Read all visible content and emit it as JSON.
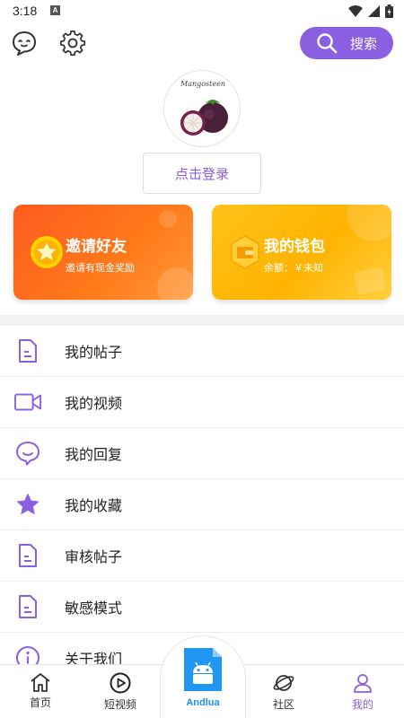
{
  "status_bar": {
    "time": "3:18",
    "notification_badge": "A"
  },
  "top_bar": {
    "search_label": "搜索",
    "accent": "#8a5fe0"
  },
  "profile": {
    "avatar_caption": "Mangosteen",
    "login_label": "点击登录"
  },
  "cards": {
    "invite": {
      "title": "邀请好友",
      "subtitle": "邀请有现金奖励",
      "color": "#ff6a1c"
    },
    "wallet": {
      "title": "我的钱包",
      "subtitle": "余额：￥未知",
      "color": "#ffb800"
    }
  },
  "menu": [
    {
      "label": "我的帖子",
      "icon": "document-icon"
    },
    {
      "label": "我的视频",
      "icon": "video-camera-icon"
    },
    {
      "label": "我的回复",
      "icon": "chat-bubble-icon"
    },
    {
      "label": "我的收藏",
      "icon": "star-icon"
    },
    {
      "label": "审核帖子",
      "icon": "document-icon"
    },
    {
      "label": "敏感模式",
      "icon": "document-icon"
    },
    {
      "label": "关于我们",
      "icon": "info-icon"
    }
  ],
  "bottom_nav": {
    "items": [
      {
        "label": "首页",
        "icon": "home-icon"
      },
      {
        "label": "短视频",
        "icon": "play-circle-icon"
      },
      {
        "label": "Andlua",
        "icon": "android-app-icon"
      },
      {
        "label": "社区",
        "icon": "planet-icon"
      },
      {
        "label": "我的",
        "icon": "user-icon",
        "active": true
      }
    ]
  }
}
